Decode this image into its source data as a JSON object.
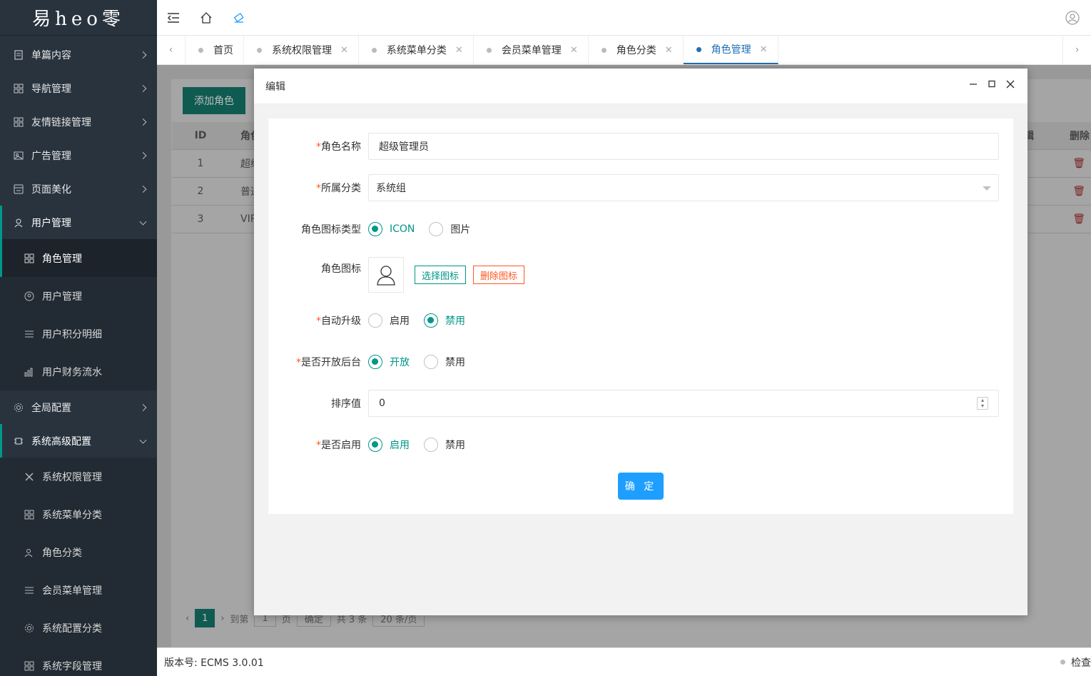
{
  "app": {
    "logo_text": "易heo零"
  },
  "sidebar": {
    "items": [
      {
        "label": "单篇内容",
        "icon": "document-icon"
      },
      {
        "label": "导航管理",
        "icon": "grid-icon"
      },
      {
        "label": "友情链接管理",
        "icon": "grid-icon"
      },
      {
        "label": "广告管理",
        "icon": "image-icon"
      },
      {
        "label": "页面美化",
        "icon": "layout-icon"
      },
      {
        "label": "用户管理",
        "icon": "user-icon"
      }
    ],
    "user_sub": [
      {
        "label": "角色管理",
        "icon": "grid-icon"
      },
      {
        "label": "用户管理",
        "icon": "user-circle-icon"
      },
      {
        "label": "用户积分明细",
        "icon": "list-icon"
      },
      {
        "label": "用户财务流水",
        "icon": "chart-icon"
      }
    ],
    "items2": [
      {
        "label": "全局配置",
        "icon": "gear-icon"
      },
      {
        "label": "系统高级配置",
        "icon": "chip-icon"
      }
    ],
    "sys_sub": [
      {
        "label": "系统权限管理",
        "icon": "tools-icon"
      },
      {
        "label": "系统菜单分类",
        "icon": "grid-icon"
      },
      {
        "label": "角色分类",
        "icon": "users-icon"
      },
      {
        "label": "会员菜单管理",
        "icon": "list-icon"
      },
      {
        "label": "系统配置分类",
        "icon": "gear-icon"
      },
      {
        "label": "系统字段管理",
        "icon": "grid-icon"
      }
    ]
  },
  "tabs": [
    {
      "label": "首页",
      "closable": false
    },
    {
      "label": "系统权限管理",
      "closable": true
    },
    {
      "label": "系统菜单分类",
      "closable": true
    },
    {
      "label": "会员菜单管理",
      "closable": true
    },
    {
      "label": "角色分类",
      "closable": true
    },
    {
      "label": "角色管理",
      "closable": true
    }
  ],
  "background": {
    "add_button": "添加角色",
    "headers": [
      "ID",
      "角色",
      "辑",
      "删除"
    ],
    "rows": [
      {
        "id": "1",
        "name": "超级"
      },
      {
        "id": "2",
        "name": "普通"
      },
      {
        "id": "3",
        "name": "VIP"
      }
    ],
    "pager": {
      "page": "1",
      "goto": "到第",
      "page_input": "1",
      "page_unit": "页",
      "confirm": "确定",
      "total": "共 3 条",
      "per_page": "20 条/页"
    }
  },
  "footer": {
    "version": "版本号: ECMS 3.0.01",
    "right": "检查"
  },
  "modal": {
    "title": "编辑",
    "fields": {
      "role_name": {
        "label": "角色名称",
        "value": "超级管理员"
      },
      "category": {
        "label": "所属分类",
        "value": "系统组"
      },
      "icon_type": {
        "label": "角色图标类型",
        "options": [
          "ICON",
          "图片"
        ],
        "selected": "ICON"
      },
      "icon": {
        "label": "角色图标",
        "choose": "选择图标",
        "delete": "删除图标"
      },
      "auto_upgrade": {
        "label": "自动升级",
        "options": [
          "启用",
          "禁用"
        ],
        "selected": "禁用"
      },
      "backend": {
        "label": "是否开放后台",
        "options": [
          "开放",
          "禁用"
        ],
        "selected": "开放"
      },
      "sort": {
        "label": "排序值",
        "value": "0"
      },
      "enabled": {
        "label": "是否启用",
        "options": [
          "启用",
          "禁用"
        ],
        "selected": "启用"
      }
    },
    "confirm": "确 定"
  },
  "colors": {
    "accent": "#009688",
    "primary_button": "#1e9fff",
    "danger": "#ff5722",
    "sidebar_bg": "#28333e"
  }
}
